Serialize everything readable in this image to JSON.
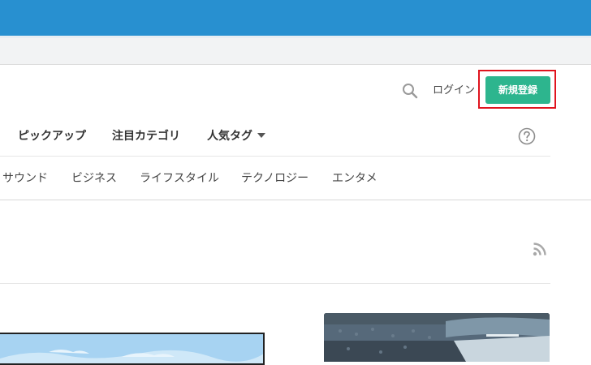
{
  "header": {
    "login_label": "ログイン",
    "signup_label": "新規登録",
    "accent_color": "#2db58e",
    "highlight_color": "#e0141e"
  },
  "nav": {
    "items": [
      {
        "label": "ピックアップ"
      },
      {
        "label": "注目カテゴリ"
      },
      {
        "label": "人気タグ"
      }
    ],
    "help_icon": "question-circle-icon"
  },
  "categories": [
    {
      "label": "サウンド"
    },
    {
      "label": "ビジネス"
    },
    {
      "label": "ライフスタイル"
    },
    {
      "label": "テクノロジー"
    },
    {
      "label": "エンタメ"
    }
  ],
  "feed": {
    "icon": "rss-icon"
  },
  "colors": {
    "browser_bar": "#2890d0"
  }
}
